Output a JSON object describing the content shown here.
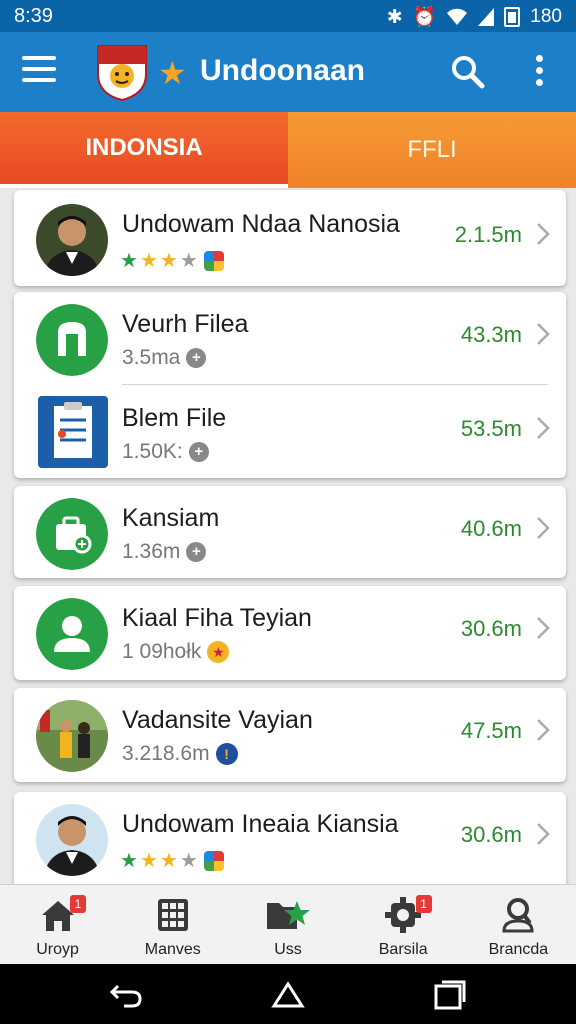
{
  "status_bar": {
    "time": "8:39",
    "battery_text": "180"
  },
  "app_bar": {
    "title": "Undoonaan"
  },
  "tabs": [
    {
      "label": "INDONSIA"
    },
    {
      "label": "FFLI"
    }
  ],
  "items": [
    {
      "name": "Undowam Ndaa Nanosia",
      "size": "2.1.5m"
    },
    {
      "name": "Veurh Filea",
      "sub": "3.5ma",
      "size": "43.3m"
    },
    {
      "name": "Blem File",
      "sub": "1.50K:",
      "size": "53.5m"
    },
    {
      "name": "Kansiam",
      "sub": "1.36m",
      "size": "40.6m"
    },
    {
      "name": "Kiaal Fiha Teyian",
      "sub": "1 09hołk",
      "size": "30.6m"
    },
    {
      "name": "Vadansite Vayian",
      "sub": "3.218.6m",
      "size": "47.5m"
    },
    {
      "name": "Undowam Ineaia Kiansia",
      "size": "30.6m"
    }
  ],
  "bottom_nav": [
    {
      "label": "Uroyp",
      "badge": "1"
    },
    {
      "label": "Manves"
    },
    {
      "label": "Uss"
    },
    {
      "label": "Barsila",
      "badge": "1"
    },
    {
      "label": "Brancda"
    }
  ],
  "colors": {
    "app_bar": "#1c7fc7",
    "tab_active": "#e84a24",
    "tab_inactive": "#f0822a",
    "size_text": "#2e8a2e"
  },
  "icons": [
    "menu-icon",
    "search-icon",
    "more-vert-icon",
    "chevron-right-icon",
    "home-icon",
    "grid-icon",
    "folder-star-icon",
    "settings-icon",
    "profile-search-icon",
    "back-icon",
    "home-button-icon",
    "recents-icon"
  ]
}
